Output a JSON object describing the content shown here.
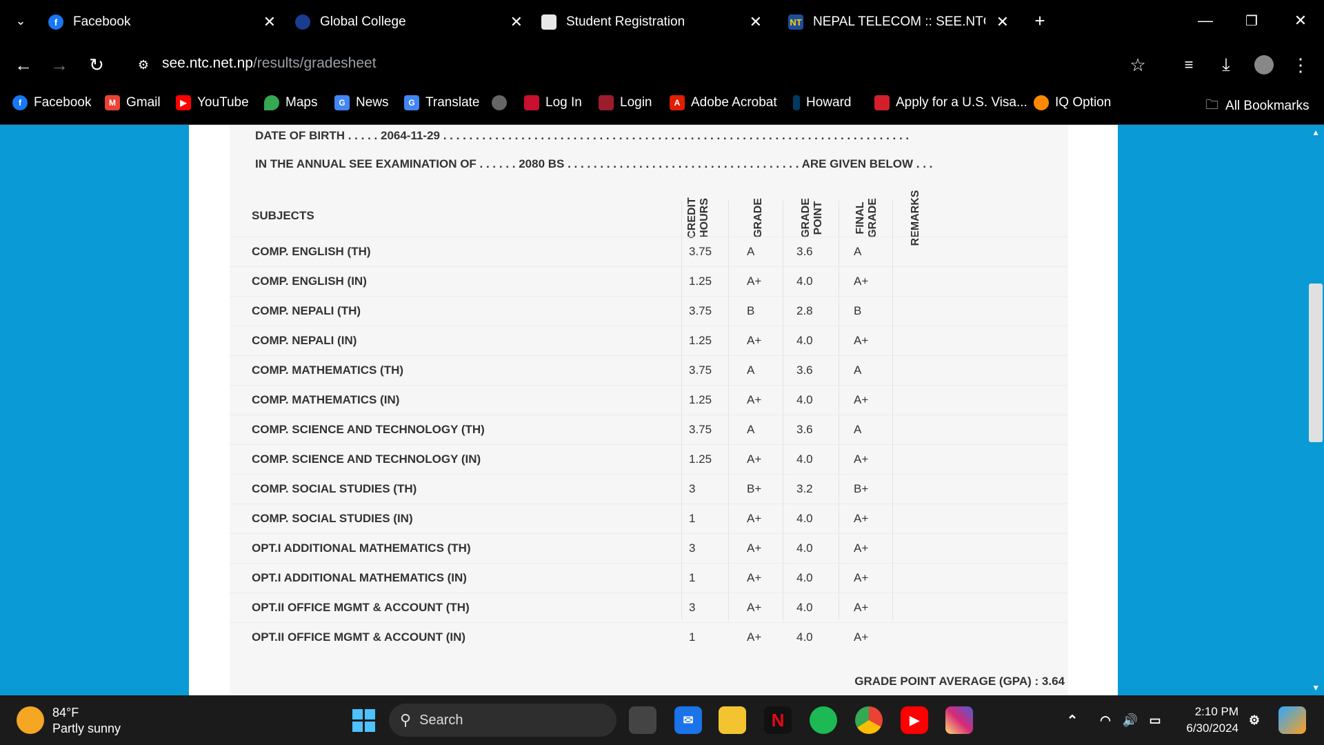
{
  "tabs": [
    {
      "title": "Facebook",
      "icon": "facebook-icon"
    },
    {
      "title": "Global College",
      "icon": "college-icon"
    },
    {
      "title": "Student Registration",
      "icon": "document-icon"
    },
    {
      "title": "NEPAL TELECOM :: SEE.NTC.NET",
      "icon": "ntc-icon",
      "icon_text": "NT"
    }
  ],
  "address": {
    "domain": "see.ntc.net.np",
    "path": "/results/gradesheet"
  },
  "bookmarks": [
    {
      "label": "Facebook",
      "icon": "facebook-icon",
      "color": "#1877f2"
    },
    {
      "label": "Gmail",
      "icon": "gmail-icon",
      "color": "#ea4335"
    },
    {
      "label": "YouTube",
      "icon": "youtube-icon",
      "color": "#ff0000"
    },
    {
      "label": "Maps",
      "icon": "maps-icon",
      "color": "#34a853"
    },
    {
      "label": "News",
      "icon": "news-icon",
      "color": "#4285f4"
    },
    {
      "label": "Translate",
      "icon": "translate-icon",
      "color": "#4285f4"
    },
    {
      "label": "",
      "icon": "globe-icon",
      "color": "#666666"
    },
    {
      "label": "Log In",
      "icon": "login-icon",
      "color": "#c8102e"
    },
    {
      "label": "Login",
      "icon": "login-icon",
      "color": "#9c1c2b"
    },
    {
      "label": "Adobe Acrobat",
      "icon": "acrobat-icon",
      "color": "#e01e00"
    },
    {
      "label": "Howard",
      "icon": "howard-icon",
      "color": "#003a63"
    },
    {
      "label": "Apply for a U.S. Visa...",
      "icon": "visa-icon",
      "color": "#d21f2b"
    },
    {
      "label": "IQ Option",
      "icon": "iqoption-icon",
      "color": "#ff8a00"
    }
  ],
  "all_bookmarks": "All Bookmarks",
  "result": {
    "dob_label": "DATE OF BIRTH",
    "dob_value": "2064-11-29",
    "exam_label": "IN THE ANNUAL SEE EXAMINATION OF",
    "exam_value": "2080 BS",
    "given_below": "ARE GIVEN BELOW . . .",
    "headers": {
      "subjects": "SUBJECTS",
      "credit_l1": "CREDIT",
      "credit_l2": "HOURS",
      "grade": "GRADE",
      "point_l1": "GRADE",
      "point_l2": "POINT",
      "final_l1": "FINAL",
      "final_l2": "GRADE",
      "remarks": "REMARKS"
    },
    "rows": [
      {
        "subject": "COMP. ENGLISH (TH)",
        "credit": "3.75",
        "grade": "A",
        "point": "3.6",
        "final": "A"
      },
      {
        "subject": "COMP. ENGLISH (IN)",
        "credit": "1.25",
        "grade": "A+",
        "point": "4.0",
        "final": "A+"
      },
      {
        "subject": "COMP. NEPALI (TH)",
        "credit": "3.75",
        "grade": "B",
        "point": "2.8",
        "final": "B"
      },
      {
        "subject": "COMP. NEPALI (IN)",
        "credit": "1.25",
        "grade": "A+",
        "point": "4.0",
        "final": "A+"
      },
      {
        "subject": "COMP. MATHEMATICS (TH)",
        "credit": "3.75",
        "grade": "A",
        "point": "3.6",
        "final": "A"
      },
      {
        "subject": "COMP. MATHEMATICS (IN)",
        "credit": "1.25",
        "grade": "A+",
        "point": "4.0",
        "final": "A+"
      },
      {
        "subject": "COMP. SCIENCE AND TECHNOLOGY (TH)",
        "credit": "3.75",
        "grade": "A",
        "point": "3.6",
        "final": "A"
      },
      {
        "subject": "COMP. SCIENCE AND TECHNOLOGY (IN)",
        "credit": "1.25",
        "grade": "A+",
        "point": "4.0",
        "final": "A+"
      },
      {
        "subject": "COMP. SOCIAL STUDIES (TH)",
        "credit": "3",
        "grade": "B+",
        "point": "3.2",
        "final": "B+"
      },
      {
        "subject": "COMP. SOCIAL STUDIES (IN)",
        "credit": "1",
        "grade": "A+",
        "point": "4.0",
        "final": "A+"
      },
      {
        "subject": "OPT.I ADDITIONAL MATHEMATICS (TH)",
        "credit": "3",
        "grade": "A+",
        "point": "4.0",
        "final": "A+"
      },
      {
        "subject": "OPT.I ADDITIONAL MATHEMATICS (IN)",
        "credit": "1",
        "grade": "A+",
        "point": "4.0",
        "final": "A+"
      },
      {
        "subject": "OPT.II OFFICE MGMT & ACCOUNT (TH)",
        "credit": "3",
        "grade": "A+",
        "point": "4.0",
        "final": "A+"
      },
      {
        "subject": "OPT.II OFFICE MGMT & ACCOUNT (IN)",
        "credit": "1",
        "grade": "A+",
        "point": "4.0",
        "final": "A+"
      }
    ],
    "gpa": "GRADE POINT AVERAGE (GPA) : 3.64"
  },
  "taskbar": {
    "weather_temp": "84°F",
    "weather_desc": "Partly sunny",
    "search_placeholder": "Search",
    "time": "2:10 PM",
    "date": "6/30/2024"
  },
  "colors": {
    "page_bg": "#0a9ad6",
    "chrome_bg": "#000000",
    "taskbar_bg": "#1b1b1b"
  }
}
